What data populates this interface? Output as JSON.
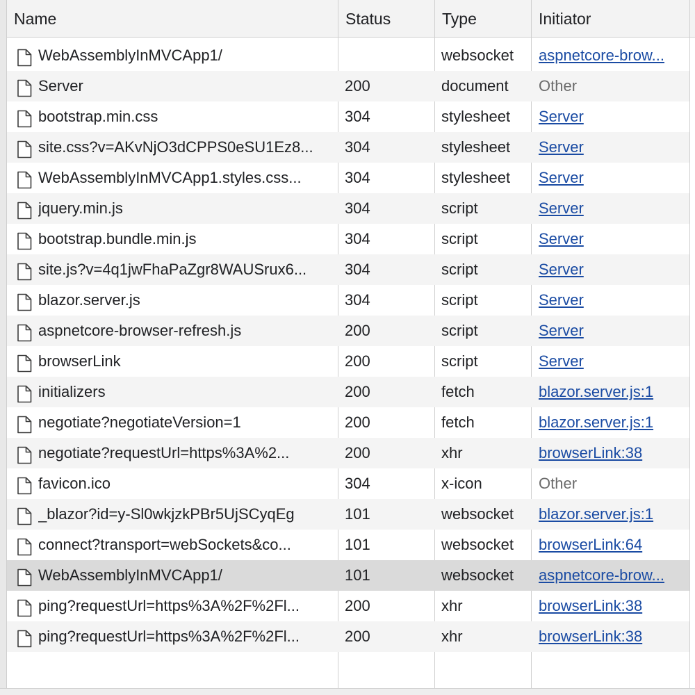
{
  "columns": {
    "name": "Name",
    "status": "Status",
    "type": "Type",
    "initiator": "Initiator"
  },
  "rows": [
    {
      "name": "WebAssemblyInMVCApp1/",
      "status": "",
      "type": "websocket",
      "initiator": "aspnetcore-brow...",
      "initiator_is_link": true,
      "selected": false
    },
    {
      "name": "Server",
      "status": "200",
      "type": "document",
      "initiator": "Other",
      "initiator_is_link": false,
      "selected": false
    },
    {
      "name": "bootstrap.min.css",
      "status": "304",
      "type": "stylesheet",
      "initiator": "Server",
      "initiator_is_link": true,
      "selected": false
    },
    {
      "name": "site.css?v=AKvNjO3dCPPS0eSU1Ez8...",
      "status": "304",
      "type": "stylesheet",
      "initiator": "Server",
      "initiator_is_link": true,
      "selected": false
    },
    {
      "name": "WebAssemblyInMVCApp1.styles.css...",
      "status": "304",
      "type": "stylesheet",
      "initiator": "Server",
      "initiator_is_link": true,
      "selected": false
    },
    {
      "name": "jquery.min.js",
      "status": "304",
      "type": "script",
      "initiator": "Server",
      "initiator_is_link": true,
      "selected": false
    },
    {
      "name": "bootstrap.bundle.min.js",
      "status": "304",
      "type": "script",
      "initiator": "Server",
      "initiator_is_link": true,
      "selected": false
    },
    {
      "name": "site.js?v=4q1jwFhaPaZgr8WAUSrux6...",
      "status": "304",
      "type": "script",
      "initiator": "Server",
      "initiator_is_link": true,
      "selected": false
    },
    {
      "name": "blazor.server.js",
      "status": "304",
      "type": "script",
      "initiator": "Server",
      "initiator_is_link": true,
      "selected": false
    },
    {
      "name": "aspnetcore-browser-refresh.js",
      "status": "200",
      "type": "script",
      "initiator": "Server",
      "initiator_is_link": true,
      "selected": false
    },
    {
      "name": "browserLink",
      "status": "200",
      "type": "script",
      "initiator": "Server",
      "initiator_is_link": true,
      "selected": false
    },
    {
      "name": "initializers",
      "status": "200",
      "type": "fetch",
      "initiator": "blazor.server.js:1",
      "initiator_is_link": true,
      "selected": false
    },
    {
      "name": "negotiate?negotiateVersion=1",
      "status": "200",
      "type": "fetch",
      "initiator": "blazor.server.js:1",
      "initiator_is_link": true,
      "selected": false
    },
    {
      "name": "negotiate?requestUrl=https%3A%2...",
      "status": "200",
      "type": "xhr",
      "initiator": "browserLink:38",
      "initiator_is_link": true,
      "selected": false
    },
    {
      "name": "favicon.ico",
      "status": "304",
      "type": "x-icon",
      "initiator": "Other",
      "initiator_is_link": false,
      "selected": false
    },
    {
      "name": "_blazor?id=y-Sl0wkjzkPBr5UjSCyqEg",
      "status": "101",
      "type": "websocket",
      "initiator": "blazor.server.js:1",
      "initiator_is_link": true,
      "selected": false
    },
    {
      "name": "connect?transport=webSockets&co...",
      "status": "101",
      "type": "websocket",
      "initiator": "browserLink:64",
      "initiator_is_link": true,
      "selected": false
    },
    {
      "name": "WebAssemblyInMVCApp1/",
      "status": "101",
      "type": "websocket",
      "initiator": "aspnetcore-brow...",
      "initiator_is_link": true,
      "selected": true
    },
    {
      "name": "ping?requestUrl=https%3A%2F%2Fl...",
      "status": "200",
      "type": "xhr",
      "initiator": "browserLink:38",
      "initiator_is_link": true,
      "selected": false
    },
    {
      "name": "ping?requestUrl=https%3A%2F%2Fl...",
      "status": "200",
      "type": "xhr",
      "initiator": "browserLink:38",
      "initiator_is_link": true,
      "selected": false
    }
  ],
  "icons": {
    "row_icon": "file-icon"
  },
  "colors": {
    "link": "#1a4ba3",
    "selected_row": "#dadada",
    "alt_row": "#f4f4f4"
  }
}
